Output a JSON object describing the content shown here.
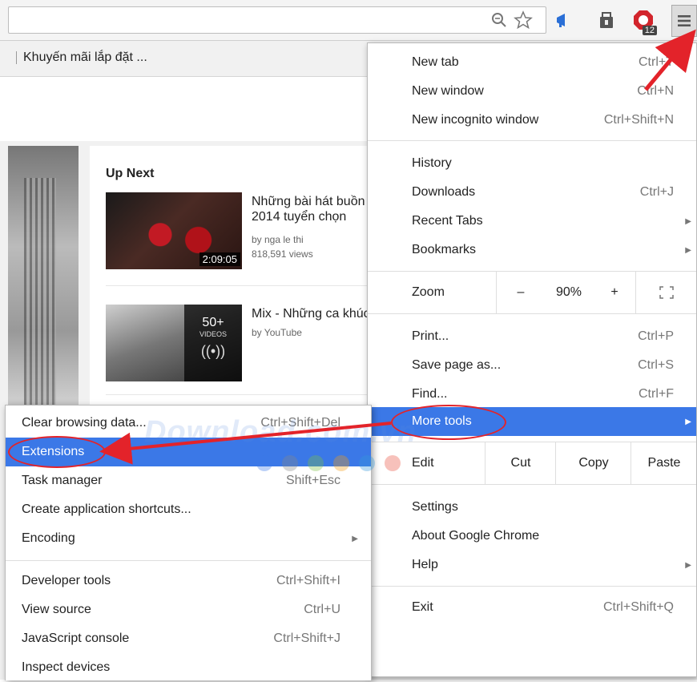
{
  "toolbar": {
    "extension_badge": "12"
  },
  "bookmarks": {
    "item": "Khuyến mãi lắp đặt ..."
  },
  "page": {
    "up_next": "Up Next",
    "recommendations": [
      {
        "title": "Những bài hát buồn\n2014 tuyển chọn",
        "channel": "by nga le thi",
        "views": "818,591 views",
        "duration": "2:09:05"
      },
      {
        "title": "Mix - Những ca khúc",
        "channel": "by YouTube",
        "count": "50+",
        "count_label": "VIDEOS"
      }
    ]
  },
  "main_menu": {
    "new_tab": {
      "label": "New tab",
      "shortcut": "Ctrl+T"
    },
    "new_window": {
      "label": "New window",
      "shortcut": "Ctrl+N"
    },
    "new_incognito": {
      "label": "New incognito window",
      "shortcut": "Ctrl+Shift+N"
    },
    "history": {
      "label": "History"
    },
    "downloads": {
      "label": "Downloads",
      "shortcut": "Ctrl+J"
    },
    "recent_tabs": {
      "label": "Recent Tabs"
    },
    "bookmarks": {
      "label": "Bookmarks"
    },
    "zoom": {
      "label": "Zoom",
      "minus": "–",
      "value": "90%",
      "plus": "+"
    },
    "print": {
      "label": "Print...",
      "shortcut": "Ctrl+P"
    },
    "save_page": {
      "label": "Save page as...",
      "shortcut": "Ctrl+S"
    },
    "find": {
      "label": "Find...",
      "shortcut": "Ctrl+F"
    },
    "more_tools": {
      "label": "More tools"
    },
    "edit": {
      "label": "Edit",
      "cut": "Cut",
      "copy": "Copy",
      "paste": "Paste"
    },
    "settings": {
      "label": "Settings"
    },
    "about": {
      "label": "About Google Chrome"
    },
    "help": {
      "label": "Help"
    },
    "exit": {
      "label": "Exit",
      "shortcut": "Ctrl+Shift+Q"
    }
  },
  "sub_menu": {
    "clear_browsing": {
      "label": "Clear browsing data...",
      "shortcut": "Ctrl+Shift+Del"
    },
    "extensions": {
      "label": "Extensions"
    },
    "task_manager": {
      "label": "Task manager",
      "shortcut": "Shift+Esc"
    },
    "create_shortcuts": {
      "label": "Create application shortcuts..."
    },
    "encoding": {
      "label": "Encoding"
    },
    "developer_tools": {
      "label": "Developer tools",
      "shortcut": "Ctrl+Shift+I"
    },
    "view_source": {
      "label": "View source",
      "shortcut": "Ctrl+U"
    },
    "js_console": {
      "label": "JavaScript console",
      "shortcut": "Ctrl+Shift+J"
    },
    "inspect_devices": {
      "label": "Inspect devices"
    }
  },
  "watermark": "Download.com.vn",
  "colors": {
    "highlight": "#3b78e7",
    "annotation": "#e3232a"
  }
}
